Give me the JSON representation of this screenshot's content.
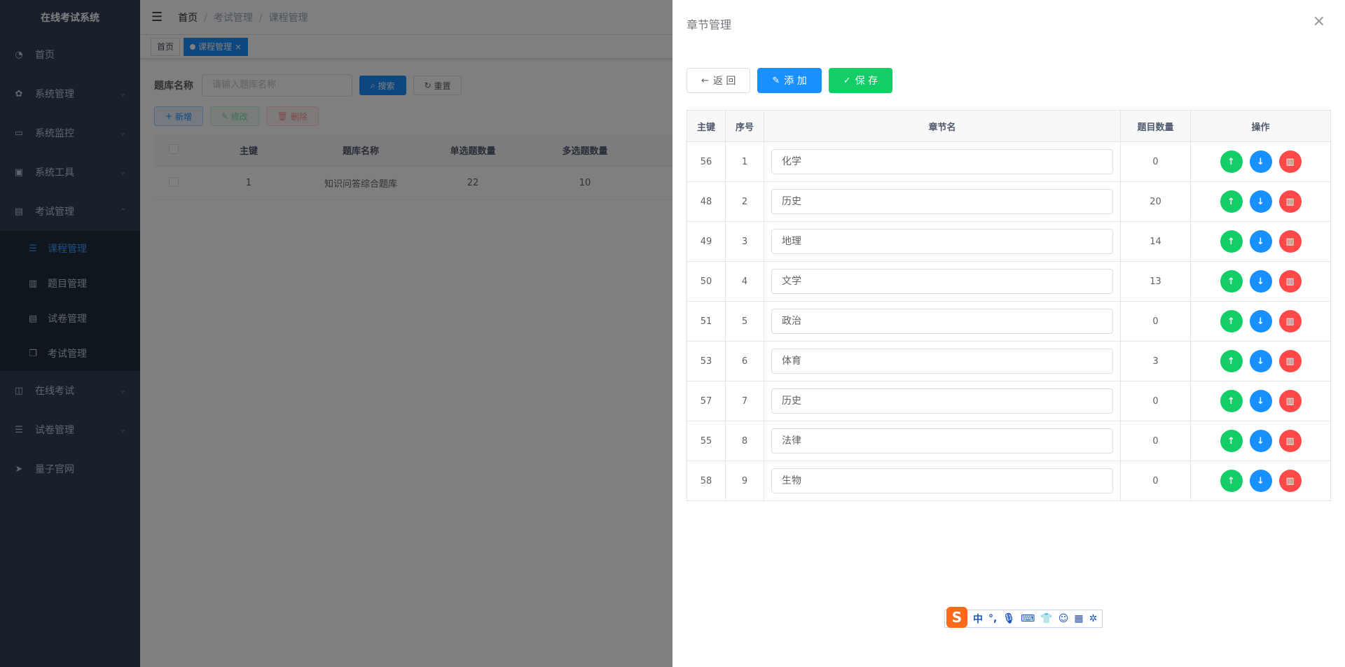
{
  "sidebar": {
    "logo": "在线考试系统",
    "items": [
      {
        "label": "首页",
        "icon": "dashboard-icon"
      },
      {
        "label": "系统管理",
        "icon": "gear-icon"
      },
      {
        "label": "系统监控",
        "icon": "monitor-icon"
      },
      {
        "label": "系统工具",
        "icon": "toolbox-icon"
      },
      {
        "label": "考试管理",
        "icon": "document-icon"
      }
    ],
    "sub_items": [
      {
        "label": "课程管理",
        "icon": "list-icon"
      },
      {
        "label": "题目管理",
        "icon": "book-icon"
      },
      {
        "label": "试卷管理",
        "icon": "paper-icon"
      },
      {
        "label": "考试管理",
        "icon": "copy-icon"
      }
    ],
    "tail_items": [
      {
        "label": "在线考试",
        "icon": "columns-icon"
      },
      {
        "label": "试卷管理",
        "icon": "list-icon"
      },
      {
        "label": "量子官网",
        "icon": "send-icon"
      }
    ]
  },
  "navbar": {
    "breadcrumb": [
      "首页",
      "考试管理",
      "课程管理"
    ]
  },
  "tags": {
    "home": "首页",
    "active": "课程管理",
    "close": "×"
  },
  "search": {
    "label": "题库名称",
    "placeholder": "请输入题库名称",
    "search_btn": "搜索",
    "reset_btn": "重置"
  },
  "toolbar": {
    "add": "新增",
    "edit": "修改",
    "delete": "删除"
  },
  "main_table": {
    "headers": [
      "主键",
      "题库名称",
      "单选题数量",
      "多选题数量"
    ],
    "rows": [
      {
        "id": "1",
        "name": "知识问答综合题库",
        "single": "22",
        "multi": "10"
      }
    ]
  },
  "drawer": {
    "title": "章节管理",
    "close": "×",
    "back_btn": "返 回",
    "add_btn": "添 加",
    "save_btn": "保 存",
    "headers": {
      "id": "主键",
      "seq": "序号",
      "name": "章节名",
      "count": "题目数量",
      "ops": "操作"
    },
    "rows": [
      {
        "id": "56",
        "seq": "1",
        "name": "化学",
        "count": "0"
      },
      {
        "id": "48",
        "seq": "2",
        "name": "历史",
        "count": "20"
      },
      {
        "id": "49",
        "seq": "3",
        "name": "地理",
        "count": "14"
      },
      {
        "id": "50",
        "seq": "4",
        "name": "文学",
        "count": "13"
      },
      {
        "id": "51",
        "seq": "5",
        "name": "政治",
        "count": "0"
      },
      {
        "id": "53",
        "seq": "6",
        "name": "体育",
        "count": "3"
      },
      {
        "id": "57",
        "seq": "7",
        "name": "历史",
        "count": "0"
      },
      {
        "id": "55",
        "seq": "8",
        "name": "法律",
        "count": "0"
      },
      {
        "id": "58",
        "seq": "9",
        "name": "生物",
        "count": "0"
      }
    ]
  },
  "ime": {
    "logo": "S",
    "mode": "中"
  }
}
